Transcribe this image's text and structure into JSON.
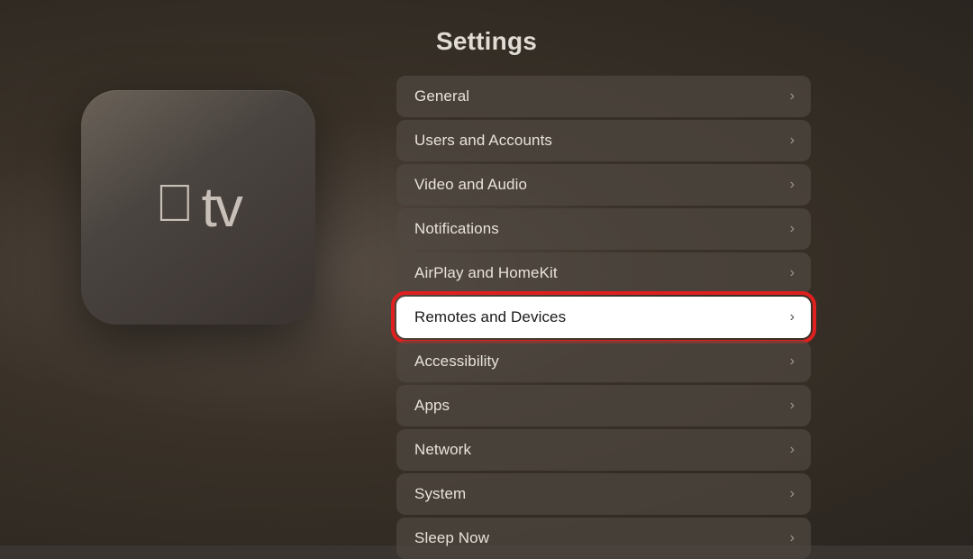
{
  "page": {
    "title": "Settings"
  },
  "device": {
    "apple_symbol": "",
    "tv_text": "tv"
  },
  "settings": {
    "items": [
      {
        "id": "general",
        "label": "General",
        "highlighted": false
      },
      {
        "id": "users-accounts",
        "label": "Users and Accounts",
        "highlighted": false
      },
      {
        "id": "video-audio",
        "label": "Video and Audio",
        "highlighted": false
      },
      {
        "id": "notifications",
        "label": "Notifications",
        "highlighted": false
      },
      {
        "id": "airplay-homekit",
        "label": "AirPlay and HomeKit",
        "highlighted": false
      },
      {
        "id": "remotes-devices",
        "label": "Remotes and Devices",
        "highlighted": true
      },
      {
        "id": "accessibility",
        "label": "Accessibility",
        "highlighted": false
      },
      {
        "id": "apps",
        "label": "Apps",
        "highlighted": false
      },
      {
        "id": "network",
        "label": "Network",
        "highlighted": false
      },
      {
        "id": "system",
        "label": "System",
        "highlighted": false
      },
      {
        "id": "sleep-now",
        "label": "Sleep Now",
        "highlighted": false
      }
    ],
    "chevron": "›"
  }
}
